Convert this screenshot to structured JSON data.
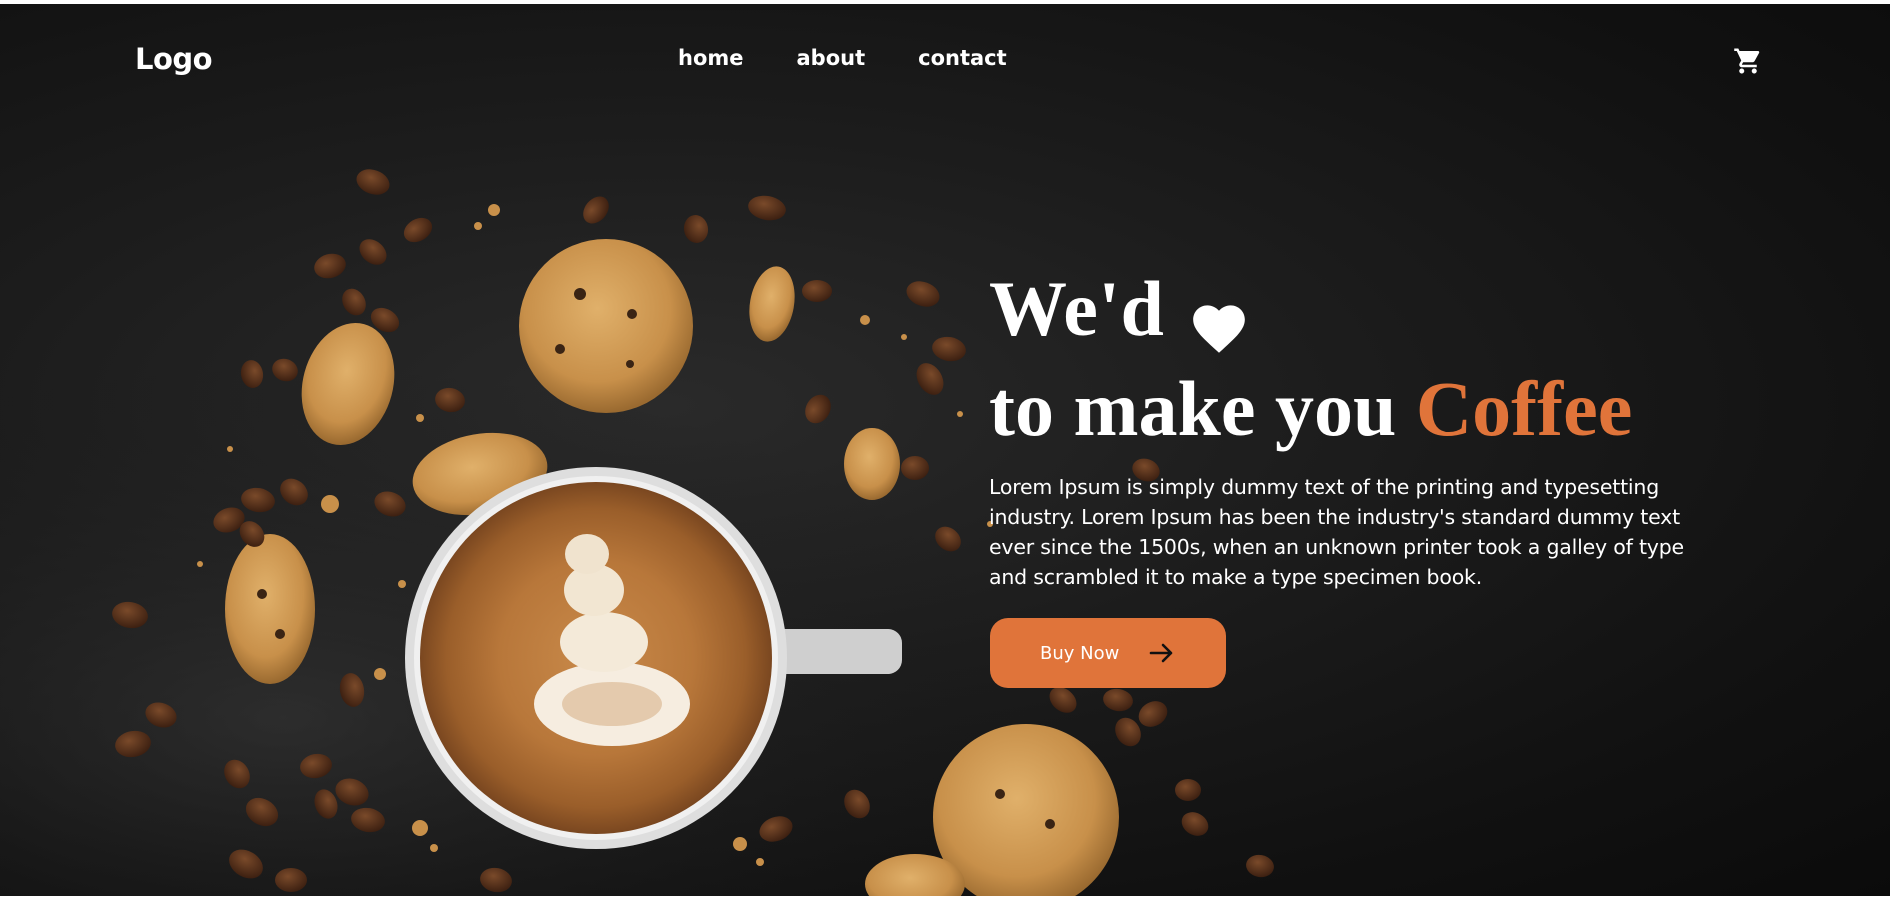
{
  "nav": {
    "logo": "Logo",
    "links": [
      "home",
      "about",
      "contact"
    ],
    "cart_icon": "shopping-cart-icon"
  },
  "hero": {
    "headline_line1": "We'd",
    "heart_icon": "heart-icon",
    "headline_line2_prefix": "to make you",
    "headline_line2_accent": "Coffee",
    "description": "Lorem Ipsum is simply dummy text of the printing and typesetting industry. Lorem Ipsum has been the industry's standard dummy text ever since the 1500s, when an unknown printer took a galley of type and scrambled it to make a type specimen book.",
    "cta_label": "Buy Now",
    "cta_icon": "arrow-right-icon"
  },
  "colors": {
    "background": "#141414",
    "accent": "#e0743a",
    "text": "#ffffff"
  }
}
